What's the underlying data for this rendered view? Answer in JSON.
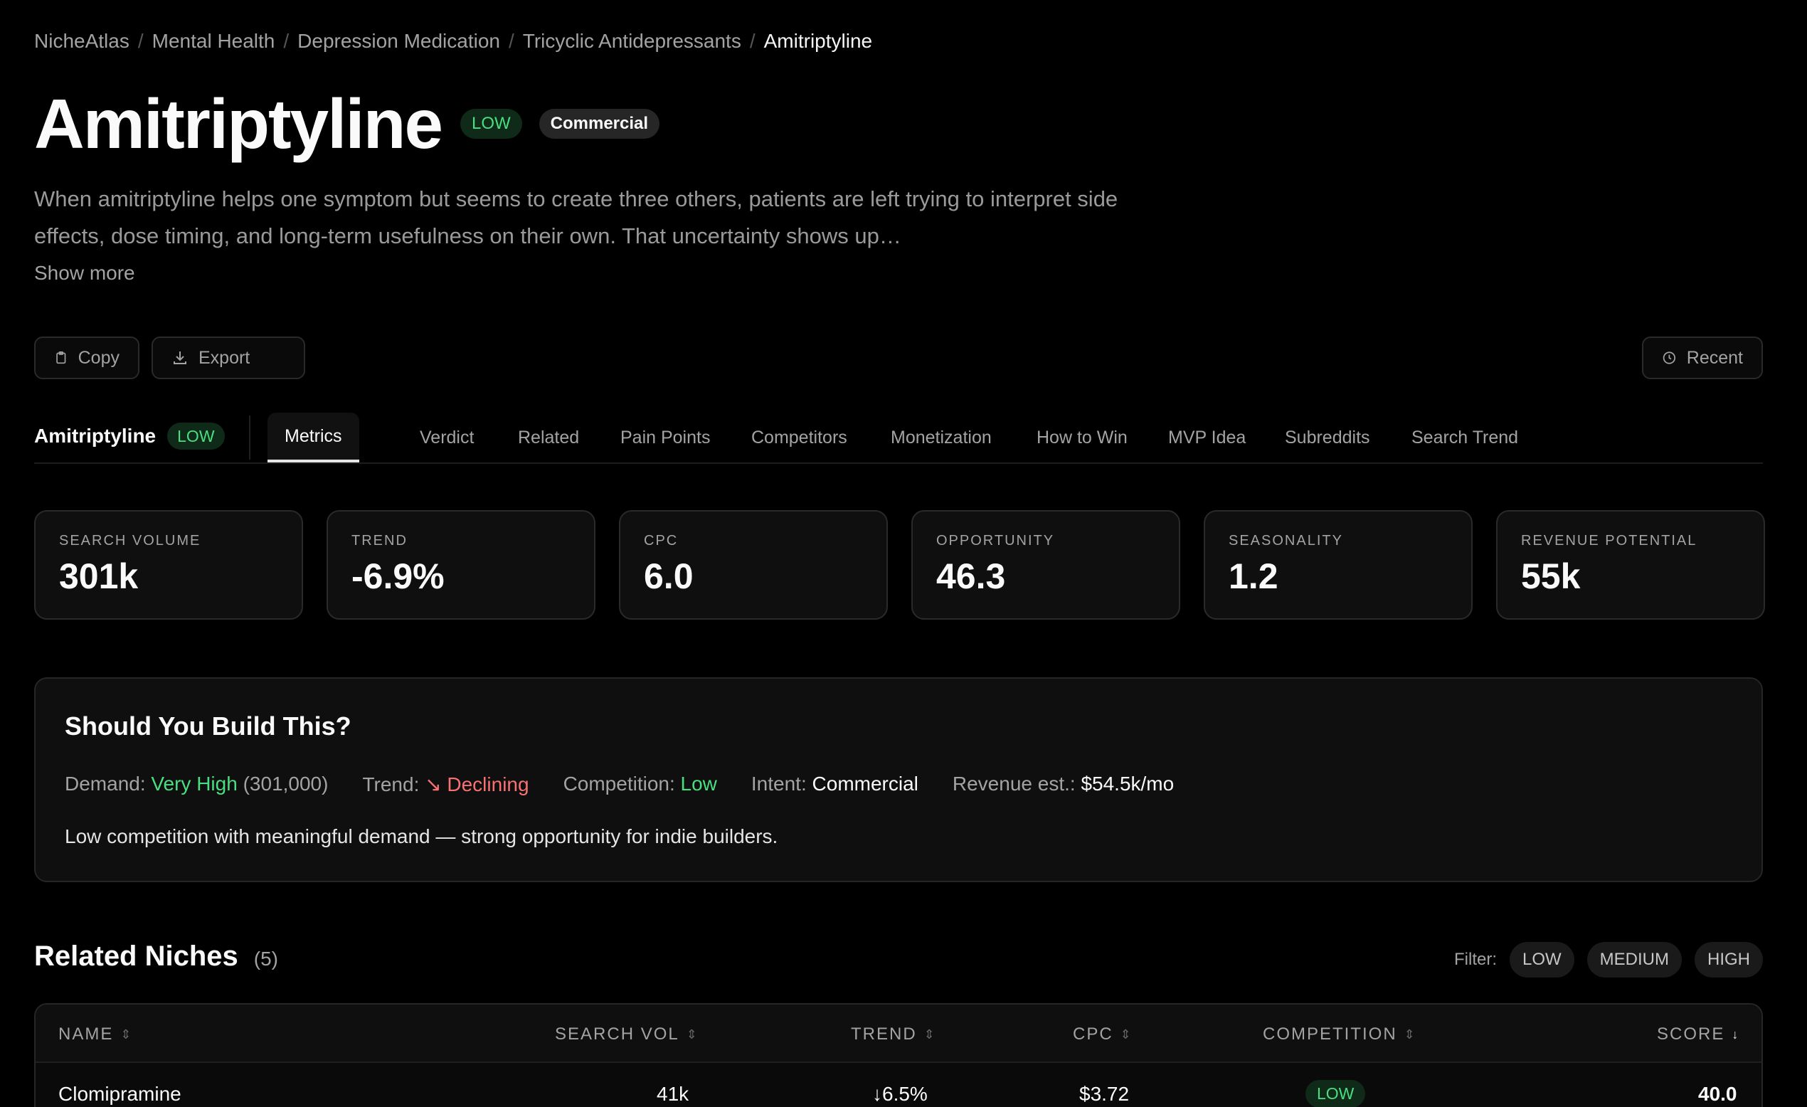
{
  "breadcrumb": [
    "NicheAtlas",
    "Mental Health",
    "Depression Medication",
    "Tricyclic Antidepressants",
    "Amitriptyline"
  ],
  "title": "Amitriptyline",
  "competition_badge": "LOW",
  "intent_badge": "Commercial",
  "description": "When amitriptyline helps one symptom but seems to create three others, patients are left trying to interpret side effects, dose timing, and long-term usefulness on their own. That uncertainty shows up…",
  "show_more": "Show more",
  "actions": {
    "copy": "Copy",
    "export": "Export",
    "recent": "Recent"
  },
  "tabbar": {
    "name": "Amitriptyline",
    "badge": "LOW",
    "tabs": [
      "Metrics",
      "Verdict",
      "Related",
      "Pain Points",
      "Competitors",
      "Monetization",
      "How to Win",
      "MVP Idea",
      "Subreddits",
      "Search Trend"
    ],
    "active": "Metrics"
  },
  "metrics": [
    {
      "label": "SEARCH VOLUME",
      "value": "301k"
    },
    {
      "label": "TREND",
      "value": "-6.9%"
    },
    {
      "label": "CPC",
      "value": "6.0"
    },
    {
      "label": "OPPORTUNITY",
      "value": "46.3"
    },
    {
      "label": "SEASONALITY",
      "value": "1.2"
    },
    {
      "label": "REVENUE POTENTIAL",
      "value": "55k"
    }
  ],
  "verdict": {
    "heading": "Should You Build This?",
    "demand_label": "Demand:",
    "demand_value": "Very High",
    "demand_detail": "(301,000)",
    "trend_label": "Trend:",
    "trend_value": "↘ Declining",
    "competition_label": "Competition:",
    "competition_value": "Low",
    "intent_label": "Intent:",
    "intent_value": "Commercial",
    "revenue_label": "Revenue est.:",
    "revenue_value": "$54.5k/mo",
    "summary": "Low competition with meaningful demand — strong opportunity for indie builders."
  },
  "related": {
    "heading": "Related Niches",
    "count": "(5)",
    "filter_label": "Filter:",
    "filters": [
      "LOW",
      "MEDIUM",
      "HIGH"
    ],
    "columns": [
      "NAME",
      "SEARCH VOL",
      "TREND",
      "CPC",
      "COMPETITION",
      "SCORE"
    ],
    "rows": [
      {
        "name": "Clomipramine",
        "search_vol": "41k",
        "trend": "↓6.5%",
        "cpc": "$3.72",
        "competition": "LOW",
        "score": "40.0"
      }
    ]
  },
  "colors": {
    "accent_green": "#4ade80",
    "accent_red": "#f87171",
    "background": "#000000",
    "card": "#0f0f0f"
  },
  "icons": {
    "copy": "clipboard-icon",
    "export": "download-icon",
    "recent": "clock-icon",
    "sort": "sort-icon",
    "sort_desc": "arrow-down-icon"
  }
}
